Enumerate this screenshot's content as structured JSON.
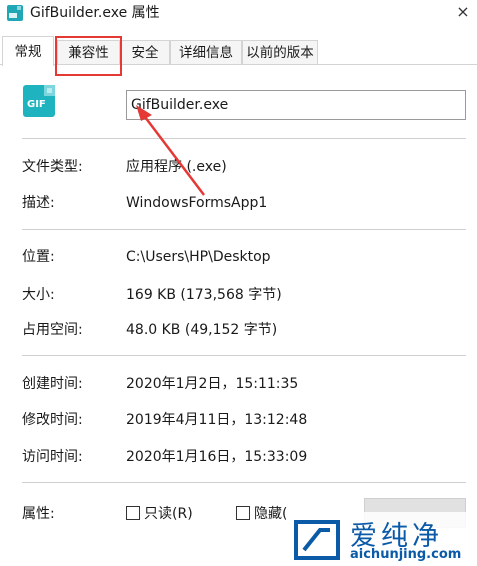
{
  "window": {
    "title": "GifBuilder.exe 属性",
    "close_glyph": "×"
  },
  "tabs": [
    {
      "label": "常规",
      "active": true
    },
    {
      "label": "兼容性",
      "active": false
    },
    {
      "label": "安全",
      "active": false
    },
    {
      "label": "详细信息",
      "active": false
    },
    {
      "label": "以前的版本",
      "active": false
    }
  ],
  "file": {
    "icon_text": "GIF",
    "name": "GifBuilder.exe"
  },
  "props": {
    "type_label": "文件类型:",
    "type_value": "应用程序 (.exe)",
    "desc_label": "描述:",
    "desc_value": "WindowsFormsApp1",
    "location_label": "位置:",
    "location_value": "C:\\Users\\HP\\Desktop",
    "size_label": "大小:",
    "size_value": "169 KB (173,568 字节)",
    "disk_label": "占用空间:",
    "disk_value": "48.0 KB (49,152 字节)",
    "created_label": "创建时间:",
    "created_value": "2020年1月2日，15:11:35",
    "modified_label": "修改时间:",
    "modified_value": "2019年4月11日，13:12:48",
    "accessed_label": "访问时间:",
    "accessed_value": "2020年1月16日，15:33:09"
  },
  "attributes": {
    "label": "属性:",
    "readonly_label": "只读(R)",
    "hidden_label": "隐藏("
  },
  "watermark": {
    "brand": "爱纯净",
    "url": "aichunjing.com"
  },
  "colors": {
    "highlight": "#e53935",
    "watermark": "#0a5aa8"
  }
}
